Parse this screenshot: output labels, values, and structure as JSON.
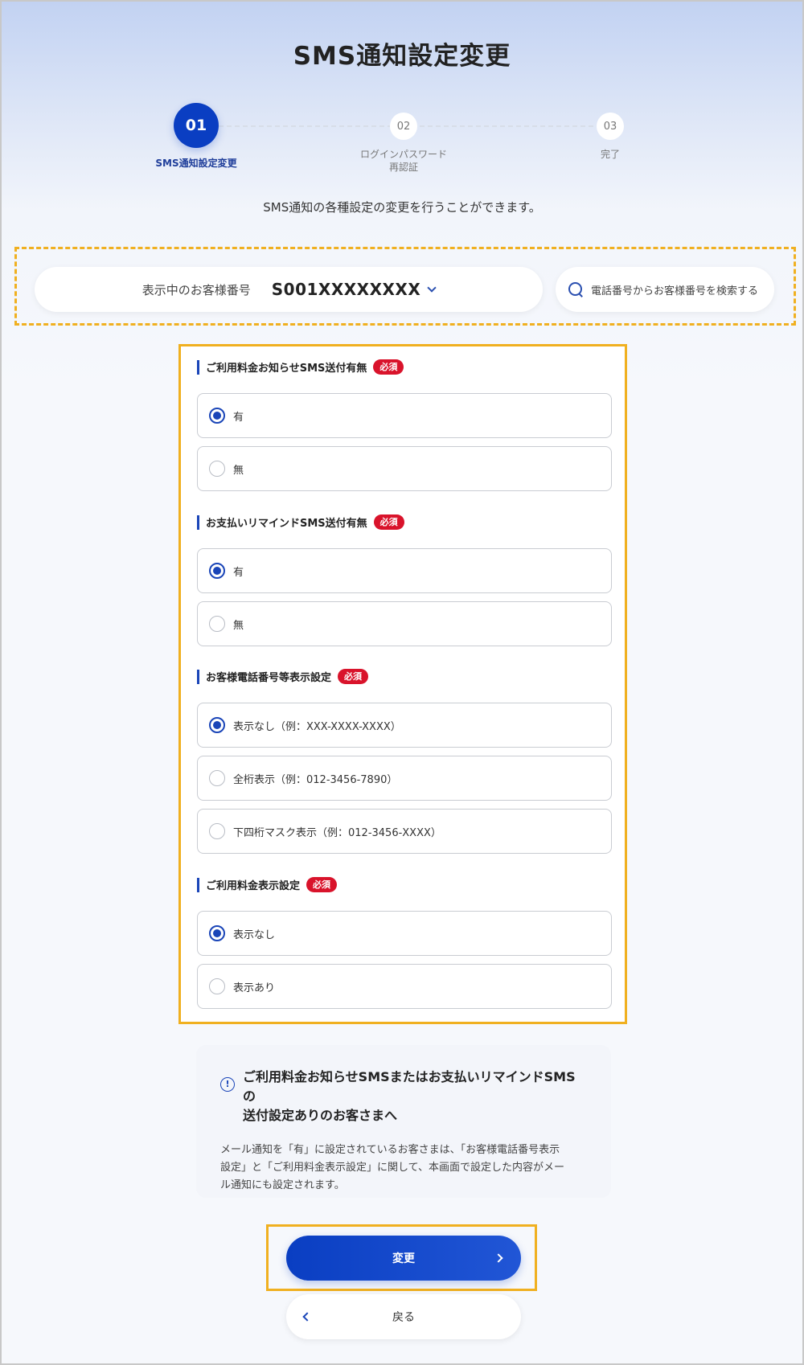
{
  "page": {
    "title": "SMS通知設定変更",
    "description": "SMS通知の各種設定の変更を行うことができます。"
  },
  "stepper": {
    "steps": [
      {
        "number": "01",
        "label": "SMS通知設定変更",
        "state": "active"
      },
      {
        "number": "02",
        "label_line1": "ログインパスワード",
        "label_line2": "再認証",
        "state": "inactive"
      },
      {
        "number": "03",
        "label": "完了",
        "state": "inactive"
      }
    ]
  },
  "customer": {
    "label": "表示中のお客様番号",
    "number": "S001XXXXXXXX",
    "search_label": "電話番号からお客様番号を検索する"
  },
  "form": {
    "required_badge": "必須",
    "groups": [
      {
        "title": "ご利用料金お知らせSMS送付有無",
        "options": [
          {
            "label": "有",
            "checked": true
          },
          {
            "label": "無",
            "checked": false
          }
        ]
      },
      {
        "title": "お支払いリマインドSMS送付有無",
        "options": [
          {
            "label": "有",
            "checked": true
          },
          {
            "label": "無",
            "checked": false
          }
        ]
      },
      {
        "title": "お客様電話番号等表示設定",
        "options": [
          {
            "label": "表示なし（例：XXX-XXXX-XXXX）",
            "checked": true
          },
          {
            "label": "全桁表示（例：012-3456-7890）",
            "checked": false
          },
          {
            "label": "下四桁マスク表示（例：012-3456-XXXX）",
            "checked": false
          }
        ]
      },
      {
        "title": "ご利用料金表示設定",
        "options": [
          {
            "label": "表示なし",
            "checked": true
          },
          {
            "label": "表示あり",
            "checked": false
          }
        ]
      }
    ]
  },
  "notice": {
    "icon": "info-icon",
    "icon_glyph": "!",
    "title_line1": "ご利用料金お知らせSMSまたはお支払いリマインドSMSの",
    "title_line2": "送付設定ありのお客さまへ",
    "body_line1": "メール通知を「有」に設定されているお客さまは、「お客様電話番号表示",
    "body_line2": "設定」と「ご利用料金表示設定」に関して、本画面で設定した内容がメー",
    "body_line3": "ル通知にも設定されます。"
  },
  "actions": {
    "submit_label": "変更",
    "back_label": "戻る"
  },
  "colors": {
    "primary": "#0a3ec2",
    "required": "#d9132b",
    "highlight": "#f0b020"
  }
}
